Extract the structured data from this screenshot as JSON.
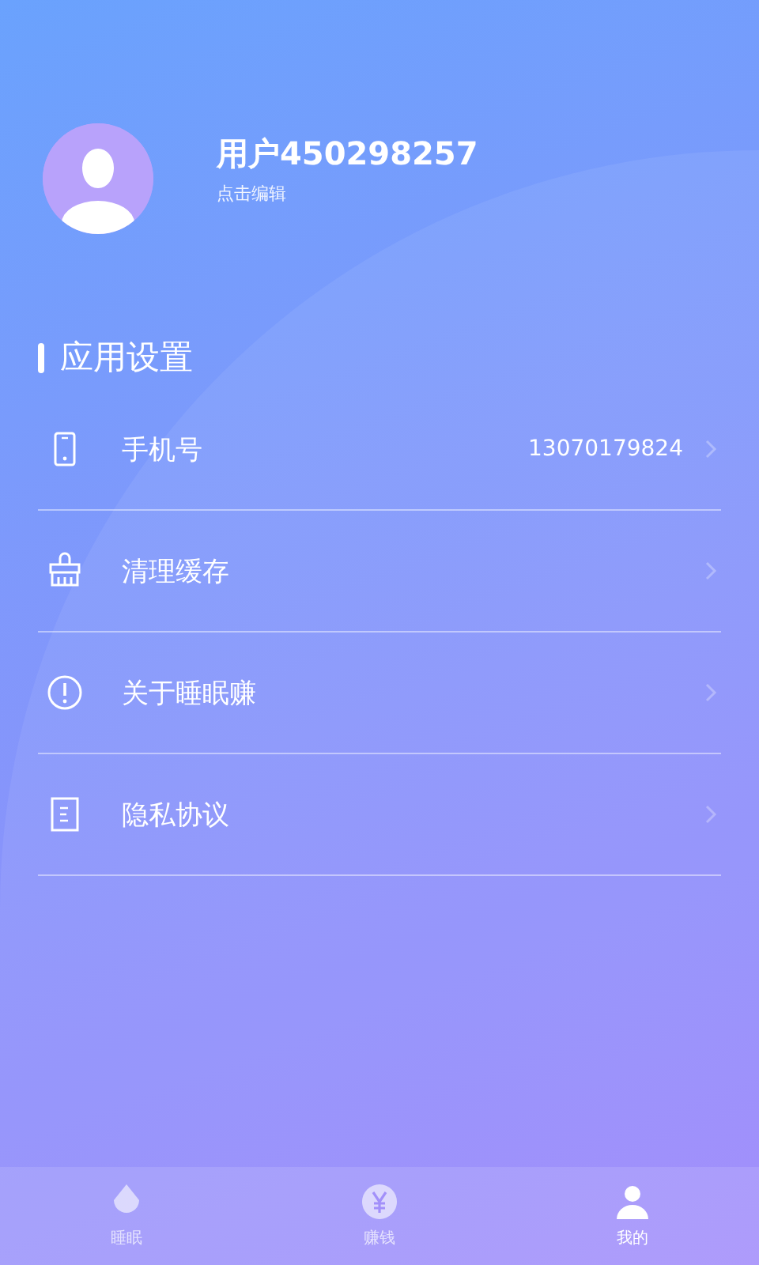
{
  "profile": {
    "name": "用户450298257",
    "edit_hint": "点击编辑"
  },
  "section_title": "应用设置",
  "settings": [
    {
      "kind": "phone",
      "label": "手机号",
      "value": "13070179824"
    },
    {
      "kind": "clean",
      "label": "清理缓存"
    },
    {
      "kind": "about",
      "label": "关于睡眠赚"
    },
    {
      "kind": "privacy",
      "label": "隐私协议"
    }
  ],
  "tabs": [
    {
      "kind": "sleep",
      "label": "睡眠",
      "selected": false
    },
    {
      "kind": "earn",
      "label": "赚钱",
      "selected": false
    },
    {
      "kind": "me",
      "label": "我的",
      "selected": true
    }
  ]
}
